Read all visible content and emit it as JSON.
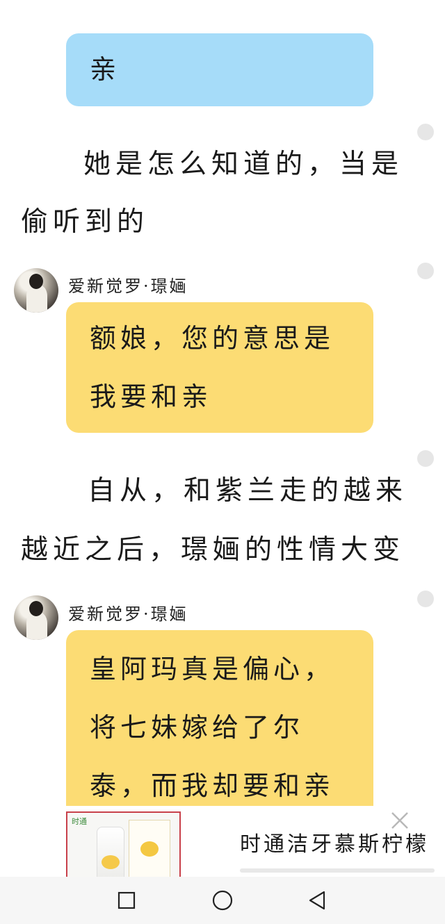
{
  "messages": {
    "bubble1": {
      "lines": [
        "亲"
      ]
    },
    "narration1": {
      "line1": "她是怎么知道的，当是",
      "line2": "偷听到的"
    },
    "sender1": {
      "name": "爱新觉罗·璟婳"
    },
    "bubble2": {
      "lines": [
        "额娘，您的意思是",
        "我要和亲"
      ]
    },
    "narration2": {
      "line1": "自从，和紫兰走的越来",
      "line2": "越近之后，璟婳的性情大变"
    },
    "sender2": {
      "name": "爱新觉罗·璟婳"
    },
    "bubble3": {
      "lines": [
        "皇阿玛真是偏心，",
        "将七妹嫁给了尔",
        "泰，而我却要和亲"
      ]
    }
  },
  "ad": {
    "title": "时通洁牙慕斯柠檬",
    "brand_logo": "时通"
  },
  "colors": {
    "blue_bubble": "#a6dcf9",
    "yellow_bubble": "#fcdc74",
    "ad_border": "#c8404a"
  },
  "icons": [
    "recents-square-icon",
    "home-circle-icon",
    "back-triangle-icon",
    "close-icon"
  ]
}
